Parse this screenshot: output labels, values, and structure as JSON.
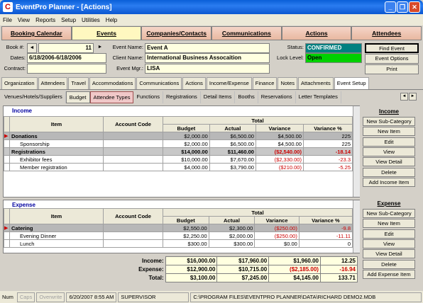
{
  "window": {
    "title": "EventPro Planner - [Actions]"
  },
  "menu": [
    "File",
    "View",
    "Reports",
    "Setup",
    "Utilities",
    "Help"
  ],
  "main_tabs": [
    "Booking Calendar",
    "Events",
    "Companies/Contacts",
    "Communications",
    "Actions",
    "Attendees"
  ],
  "header": {
    "book_label": "Book #:",
    "book_value": "11",
    "dates_label": "Dates:",
    "dates_value": "6/18/2006-6/18/2006",
    "contract_label": "Contract:",
    "event_name_label": "Event Name:",
    "event_name_value": "Event A",
    "client_name_label": "Client Name:",
    "client_name_value": "International Business Assocaition",
    "event_mgr_label": "Event Mgr.:",
    "event_mgr_value": "LISA",
    "status_label": "Status:",
    "status_value": "CONFIRMED",
    "lock_label": "Lock Level:",
    "lock_value": "Open",
    "find_event": "Find Event",
    "event_options": "Event Options",
    "print": "Print"
  },
  "sub_tabs": [
    "Organization",
    "Attendees",
    "Travel",
    "Accommodations",
    "Communications",
    "Actions",
    "Income/Expense",
    "Finance",
    "Notes",
    "Attachments",
    "Event Setup"
  ],
  "setup_tabs": [
    "Venues/Hotels/Suppliers",
    "Budget",
    "Attendee Types",
    "Functions",
    "Registrations",
    "Detail Items",
    "Booths",
    "Reservations",
    "Letter Templates"
  ],
  "income": {
    "title": "Income",
    "headers": {
      "item": "Item",
      "account": "Account Code",
      "total": "Total",
      "budget": "Budget",
      "actual": "Actual",
      "variance": "Variance",
      "variance_pct": "Variance %"
    },
    "rows": [
      {
        "item": "Donations",
        "account": "",
        "budget": "$2,000.00",
        "actual": "$6,500.00",
        "variance": "$4,500.00",
        "pct": "225",
        "style": "sel"
      },
      {
        "item": "Sponsorship",
        "account": "",
        "budget": "$2,000.00",
        "actual": "$6,500.00",
        "variance": "$4,500.00",
        "pct": "225",
        "style": "child"
      },
      {
        "item": "Registrations",
        "account": "",
        "budget": "$14,000.00",
        "actual": "$11,460.00",
        "variance": "($2,540.00)",
        "pct": "-18.14",
        "style": "grey"
      },
      {
        "item": "Exhibitor fees",
        "account": "",
        "budget": "$10,000.00",
        "actual": "$7,670.00",
        "variance": "($2,330.00)",
        "pct": "-23.3",
        "style": "child"
      },
      {
        "item": "Member registration",
        "account": "",
        "budget": "$4,000.00",
        "actual": "$3,790.00",
        "variance": "($210.00)",
        "pct": "-5.25",
        "style": "child"
      }
    ]
  },
  "expense": {
    "title": "Expense",
    "rows": [
      {
        "item": "Catering",
        "account": "",
        "budget": "$2,550.00",
        "actual": "$2,300.00",
        "variance": "($250.00)",
        "pct": "-9.8",
        "style": "sel"
      },
      {
        "item": "Evening Dinner",
        "account": "",
        "budget": "$2,250.00",
        "actual": "$2,000.00",
        "variance": "($250.00)",
        "pct": "-11.11",
        "style": "child"
      },
      {
        "item": "Lunch",
        "account": "",
        "budget": "$300.00",
        "actual": "$300.00",
        "variance": "$0.00",
        "pct": "0",
        "style": "child"
      }
    ]
  },
  "totals": [
    {
      "label": "Income:",
      "budget": "$16,000.00",
      "actual": "$17,960.00",
      "variance": "$1,960.00",
      "pct": "12.25"
    },
    {
      "label": "Expense:",
      "budget": "$12,900.00",
      "actual": "$10,715.00",
      "variance": "($2,185.00)",
      "pct": "-16.94"
    },
    {
      "label": "Total:",
      "budget": "$3,100.00",
      "actual": "$7,245.00",
      "variance": "$4,145.00",
      "pct": "133.71"
    }
  ],
  "income_buttons": {
    "title": "Income",
    "items": [
      "New Sub-Category",
      "New Item",
      "Edit",
      "View",
      "View Detail",
      "Delete",
      "Add Income Item"
    ]
  },
  "expense_buttons": {
    "title": "Expense",
    "items": [
      "New Sub-Category",
      "New Item",
      "Edit",
      "View",
      "View Detail",
      "Delete",
      "Add Expense Item"
    ]
  },
  "status": {
    "num": "Num",
    "caps": "Caps",
    "overwrite": "Overwrite",
    "datetime": "6/20/2007 8:55 AM",
    "user": "SUPERVISOR",
    "path": "C:\\PROGRAM FILES\\EVENTPRO PLANNER\\DATA\\RICHARD DEMO2.MDB"
  }
}
